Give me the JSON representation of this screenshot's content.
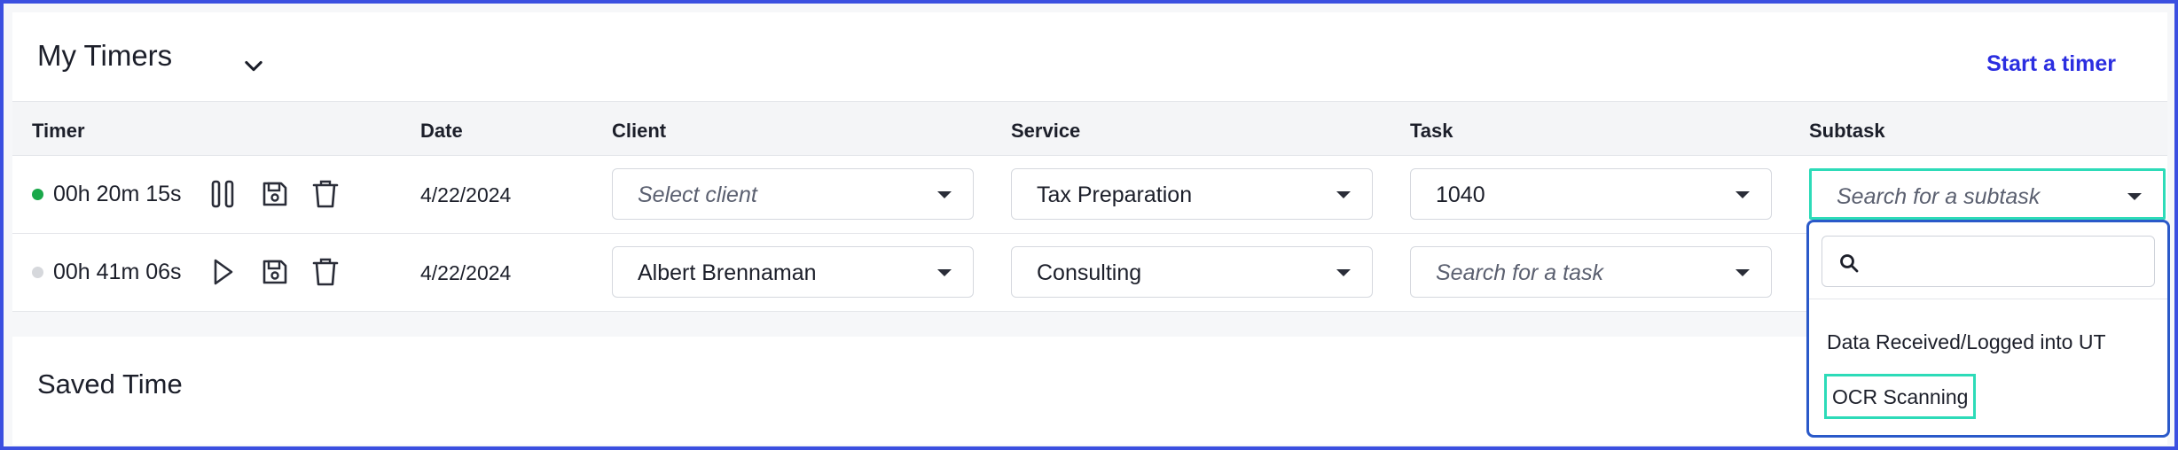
{
  "header": {
    "title": "My Timers",
    "start_timer_label": "Start a timer"
  },
  "table": {
    "columns": [
      "Timer",
      "Date",
      "Client",
      "Service",
      "Task",
      "Subtask"
    ],
    "rows": [
      {
        "status": "running",
        "status_color": "#1aa84a",
        "time": "00h 20m 15s",
        "action_icon": "pause-icon",
        "date": "4/22/2024",
        "client": "Select client",
        "client_is_placeholder": true,
        "service": "Tax Preparation",
        "task": "1040",
        "subtask_placeholder": "Search for a subtask"
      },
      {
        "status": "paused",
        "status_color": "#d6d8dc",
        "time": "00h 41m 06s",
        "action_icon": "play-icon",
        "date": "4/22/2024",
        "client": "Albert Brennaman",
        "client_is_placeholder": false,
        "service": "Consulting",
        "task_placeholder": "Search for a task"
      }
    ]
  },
  "saved": {
    "title": "Saved Time"
  },
  "subtask_dropdown": {
    "search_value": "",
    "options": [
      "Data Received/Logged into UT",
      "OCR Scanning"
    ],
    "highlighted_option": "OCR Scanning"
  },
  "colors": {
    "accent": "#2b2ee0",
    "focus_ring": "#2ddbb8",
    "dropdown_border": "#2a59c9"
  }
}
